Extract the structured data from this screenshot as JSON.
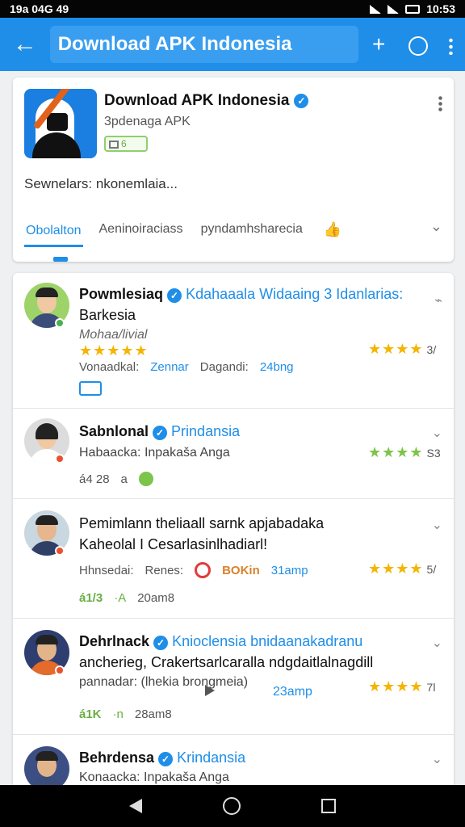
{
  "status": {
    "time": "19a 04G 49",
    "right": "10:53"
  },
  "appbar": {
    "title": "Download APK Indonesia"
  },
  "header": {
    "title": "Download APK Indonesia",
    "subtitle": "3pdenaga APK",
    "badge": "6",
    "desc": "Sewnelars: nkonemlaia...",
    "tabs": [
      "Obolalton",
      "Aeninoiraciass",
      "pyndamhsharecia"
    ]
  },
  "rows": [
    {
      "name": "Powmlesiaq",
      "org": "Kdahaaala Widaaing 3 Idanlarias:",
      "name2": "Barkesia",
      "handle": "Mohaa/livial",
      "rating_left": "★★★★★",
      "rating_right": "★★★★",
      "rating_right_num": "3/",
      "meta1": "Vonaadkal:",
      "meta2": "Zennar",
      "meta3": "Dagandi:",
      "meta4": "24bng"
    },
    {
      "name": "Sabnlonal",
      "org": "Prindansia",
      "line": "Habaacka: Inpakaša Anga",
      "stars": "★★★★",
      "stars_num": "S3",
      "meta1": "á4 28",
      "meta2": "a"
    },
    {
      "name": "Pemimlann theliaall sarnk apjabadaka",
      "name2": "Kaheolal I Cesarlasinlhadiarl!",
      "line1": "Hhnsedai:",
      "line2": "Renes:",
      "line3": "BOKin",
      "line4": "31amp",
      "stars": "★★★★",
      "stars_num": "5/",
      "meta1": "á1/3",
      "meta2": "·A",
      "meta3": "20am8"
    },
    {
      "name": "Dehrlnack",
      "org": "Knioclensia bnidaanakadranu",
      "line1": "ancherieg, Crakertsarlcaralla ndgdaitlalnagdill",
      "line2": "pannadar: (lhekia brongmeia)",
      "line3": "23amp",
      "stars": "★★★★",
      "stars_num": "7l",
      "meta1": "á1K",
      "meta2": "·n",
      "meta3": "28am8"
    },
    {
      "name": "Behrdensa",
      "org": "Krindansia",
      "line": "Konaacka: Inpakaša Anga"
    }
  ],
  "colors": {
    "primary": "#1f8ee8",
    "star": "#f4b400",
    "green": "#7cc44a"
  }
}
